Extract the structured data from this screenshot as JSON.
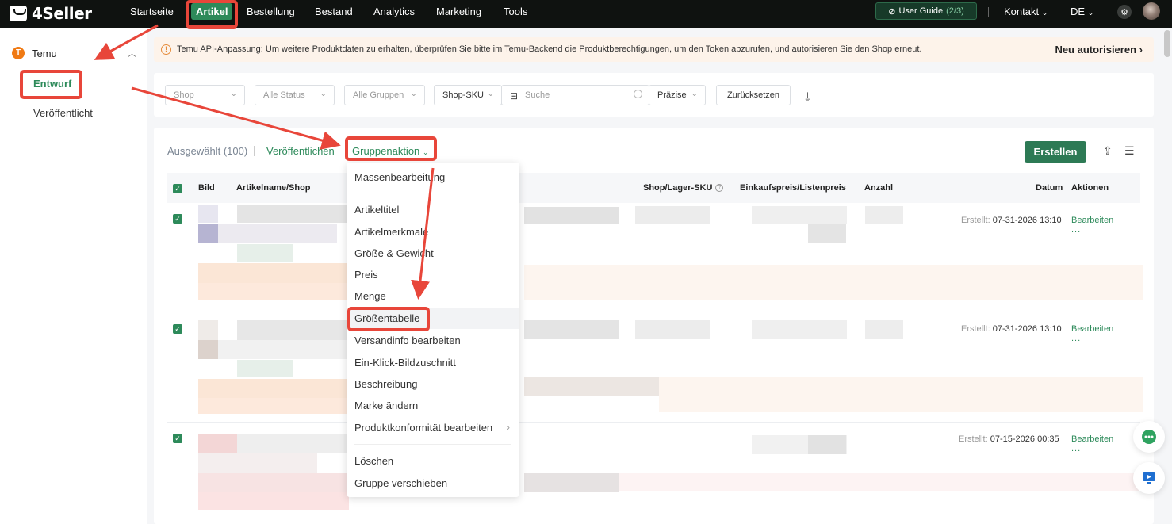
{
  "app": {
    "logo_text": "4Seller"
  },
  "nav": {
    "items": [
      "Startseite",
      "Artikel",
      "Bestellung",
      "Bestand",
      "Analytics",
      "Marketing",
      "Tools"
    ],
    "active": "Artikel",
    "guide_label": "User Guide",
    "guide_count": "(2/3)",
    "contact": "Kontakt",
    "language": "DE"
  },
  "sidebar": {
    "platform": "Temu",
    "platform_icon_letter": "T",
    "items": [
      "Entwurf",
      "Veröffentlicht"
    ],
    "active": "Entwurf"
  },
  "notice": {
    "message": "Temu API-Anpassung: Um weitere Produktdaten zu erhalten, überprüfen Sie bitte im Temu-Backend die Produktberechtigungen, um den Token abzurufen, und autorisieren Sie den Shop erneut.",
    "action": "Neu autorisieren"
  },
  "filters": {
    "shop": "Shop",
    "status": "Alle Status",
    "groups": "Alle Gruppen",
    "search_type": "Shop-SKU",
    "search_placeholder": "Suche",
    "match": "Präzise",
    "reset": "Zurücksetzen"
  },
  "toolbar": {
    "selected": "Ausgewählt (100)",
    "publish": "Veröffentlichen",
    "group_action": "Gruppenaktion",
    "create": "Erstellen"
  },
  "table": {
    "headers": {
      "image": "Bild",
      "name": "Artikelname/Shop",
      "sku": "Shop/Lager-SKU",
      "price": "Einkaufspreis/Listenpreis",
      "quantity": "Anzahl",
      "date": "Datum",
      "actions": "Aktionen"
    },
    "rows": [
      {
        "created_label": "Erstellt:",
        "created": "07-31-2026 13:10",
        "edit": "Bearbeiten",
        "more": "..."
      },
      {
        "created_label": "Erstellt:",
        "created": "07-31-2026 13:10",
        "edit": "Bearbeiten",
        "more": "..."
      },
      {
        "created_label": "Erstellt:",
        "created": "07-15-2026 00:35",
        "edit": "Bearbeiten",
        "more": "..."
      }
    ]
  },
  "dropdown": {
    "items": [
      "Massenbearbeitung",
      "Artikeltitel",
      "Artikelmerkmale",
      "Größe & Gewicht",
      "Preis",
      "Menge",
      "Größentabelle",
      "Versandinfo bearbeiten",
      "Ein-Klick-Bildzuschnitt",
      "Beschreibung",
      "Marke ändern",
      "Produktkonformität bearbeiten",
      "Löschen",
      "Gruppe verschieben"
    ],
    "highlighted": "Größentabelle"
  },
  "colors": {
    "brand": "#2d8a5a",
    "topbar": "#0f1210",
    "annotation": "#e8463a"
  }
}
